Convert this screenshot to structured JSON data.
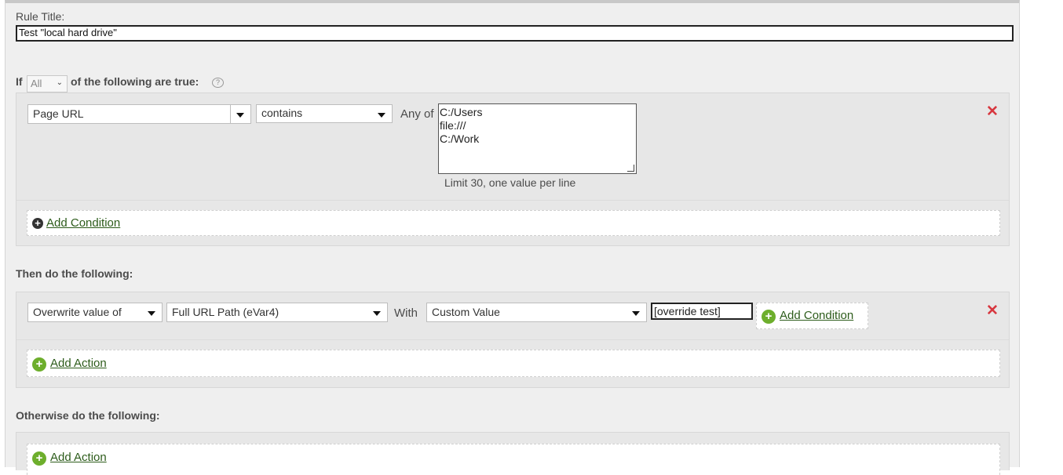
{
  "rule_title": {
    "label": "Rule Title:",
    "value": "Test \"local hard drive\""
  },
  "conditions": {
    "if_label": "If",
    "match_select": "All",
    "suffix_label": "of the following are true:",
    "help_icon": "question-icon",
    "rows": [
      {
        "field": "Page URL",
        "operator": "contains",
        "any_of_label": "Any of",
        "values": [
          "C:/Users",
          "file:///",
          "C:/Work"
        ],
        "hint": "Limit 30, one value per line",
        "remove_icon": "close-icon"
      }
    ],
    "add_condition_label": "Add Condition"
  },
  "then": {
    "heading": "Then do the following:",
    "actions": [
      {
        "action": "Overwrite value of",
        "variable": "Full URL Path (eVar4)",
        "with_label": "With",
        "value_type": "Custom Value",
        "value": "[override test]",
        "add_condition_label": "Add Condition",
        "remove_icon": "close-icon"
      }
    ],
    "add_action_label": "Add Action"
  },
  "otherwise": {
    "heading": "Otherwise do the following:",
    "add_action_label": "Add Action"
  },
  "colors": {
    "panel_bg": "#efefef",
    "link_green": "#2d5c1b",
    "plus_green": "#6dae2c",
    "remove_red": "#d7373f"
  }
}
